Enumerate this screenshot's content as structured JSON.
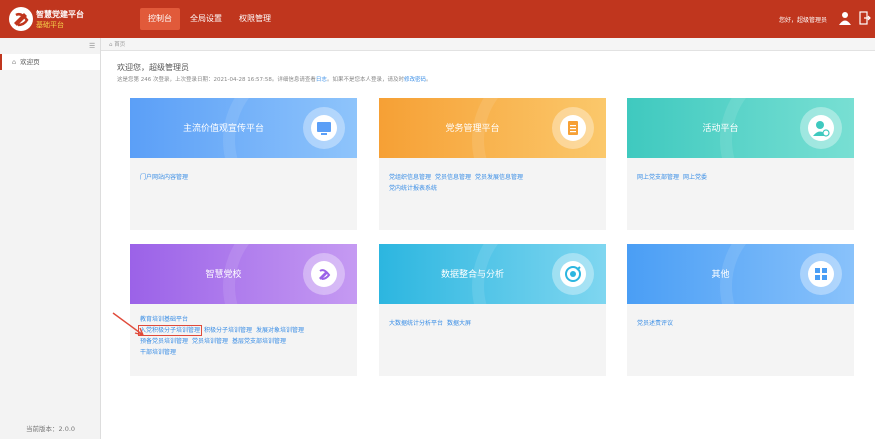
{
  "header": {
    "brand_title": "智慧党建平台",
    "brand_sub": "基础平台",
    "nav": [
      "控制台",
      "全局设置",
      "权限管理"
    ],
    "active_nav": "控制台",
    "user_text": "您好，超级管理员",
    "accent_color": "#c0361e"
  },
  "sidebar": {
    "items": [
      {
        "label": "欢迎页",
        "icon": "home-icon"
      }
    ],
    "version": "当前版本：2.0.0"
  },
  "breadcrumb": {
    "text": "首页"
  },
  "welcome": {
    "title": "欢迎您，超级管理员",
    "sub_prefix": "这是您第 246 次登录，上次登录日期：2021-04-28 16:57:58。详细信息请查看",
    "sub_log_link": "日志",
    "sub_mid": "。如果不是您本人登录，请及时",
    "sub_pwd_link": "修改密码",
    "sub_end": "。"
  },
  "cards": [
    {
      "title": "主流价值观宣传平台",
      "icon": "monitor-icon",
      "colors": [
        "#5b9ff7",
        "#8ec4fb"
      ],
      "links": [
        "门户网站内容管理"
      ]
    },
    {
      "title": "党务管理平台",
      "icon": "clipboard-icon",
      "colors": [
        "#f6a035",
        "#fbc86b"
      ],
      "links": [
        "党组织信息管理",
        "党员信息管理",
        "党员发展信息管理",
        "党内统计报表系统"
      ]
    },
    {
      "title": "活动平台",
      "icon": "user-badge-icon",
      "colors": [
        "#3fc9bf",
        "#78dfd3"
      ],
      "links": [
        "网上党支部管理",
        "网上党委"
      ]
    },
    {
      "title": "智慧党校",
      "icon": "party-emblem-icon",
      "colors": [
        "#9b62e8",
        "#c59af2"
      ],
      "links": [
        "教育培训基础平台",
        "入党积极分子培训管理",
        "积极分子培训管理",
        "发展对象培训管理",
        "预备党员培训管理",
        "党员培训管理",
        "基层党支部培训管理",
        "干部培训管理"
      ]
    },
    {
      "title": "数据整合与分析",
      "icon": "analytics-icon",
      "colors": [
        "#2cb6e0",
        "#7fd6f0"
      ],
      "links": [
        "大数据统计分析平台",
        "数据大屏"
      ]
    },
    {
      "title": "其他",
      "icon": "grid-icon",
      "colors": [
        "#4a9ef5",
        "#89c2fb"
      ],
      "links": [
        "党员述责评议"
      ]
    }
  ]
}
